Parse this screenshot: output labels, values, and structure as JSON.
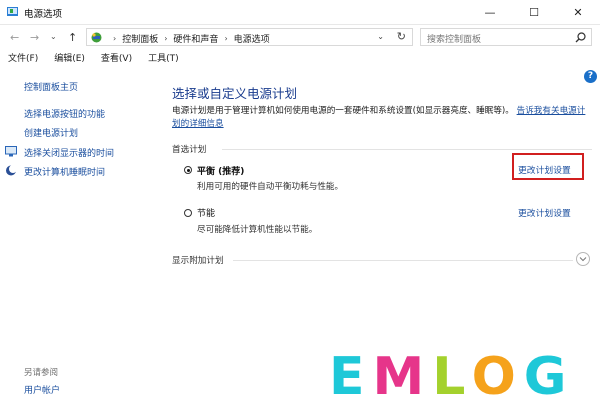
{
  "window": {
    "title": "电源选项",
    "minimize_glyph": "—",
    "maximize_glyph": "☐",
    "close_glyph": "✕"
  },
  "nav": {
    "back_glyph": "←",
    "forward_glyph": "→",
    "recent_glyph": "⌄",
    "up_glyph": "↑"
  },
  "address": {
    "crumbs": [
      "控制面板",
      "硬件和声音",
      "电源选项"
    ],
    "separator": "›",
    "dropdown_glyph": "⌄",
    "refresh_glyph": "↻"
  },
  "search": {
    "placeholder": "搜索控制面板"
  },
  "menu": [
    "文件(F)",
    "编辑(E)",
    "查看(V)",
    "工具(T)"
  ],
  "help": "?",
  "sidebar": {
    "home": "控制面板主页",
    "items": [
      "选择电源按钮的功能",
      "创建电源计划",
      "选择关闭显示器的时间",
      "更改计算机睡眠时间"
    ],
    "see_also_title": "另请参阅",
    "see_also_items": [
      "用户帐户"
    ]
  },
  "main": {
    "title": "选择或自定义电源计划",
    "description": "电源计划是用于管理计算机如何使用电源的一套硬件和系统设置(如显示器亮度、睡眠等)。",
    "description_link": "告诉我有关电源计划的详细信息",
    "preferred_heading": "首选计划",
    "plans": [
      {
        "name": "平衡 (推荐)",
        "desc": "利用可用的硬件自动平衡功耗与性能。",
        "link": "更改计划设置",
        "selected": true
      },
      {
        "name": "节能",
        "desc": "尽可能降低计算机性能以节能。",
        "link": "更改计划设置",
        "selected": false
      }
    ],
    "extra_plans": "显示附加计划"
  },
  "watermark": {
    "letters": [
      "E",
      "M",
      "L",
      "O",
      "G"
    ],
    "colors": [
      "#1ec8d8",
      "#e6358a",
      "#a4d12d",
      "#f5a21b",
      "#1ec8d8"
    ]
  },
  "colors": {
    "link": "#1a4e9e",
    "title": "#1a3c8e",
    "highlight_box": "#d11f1f"
  }
}
